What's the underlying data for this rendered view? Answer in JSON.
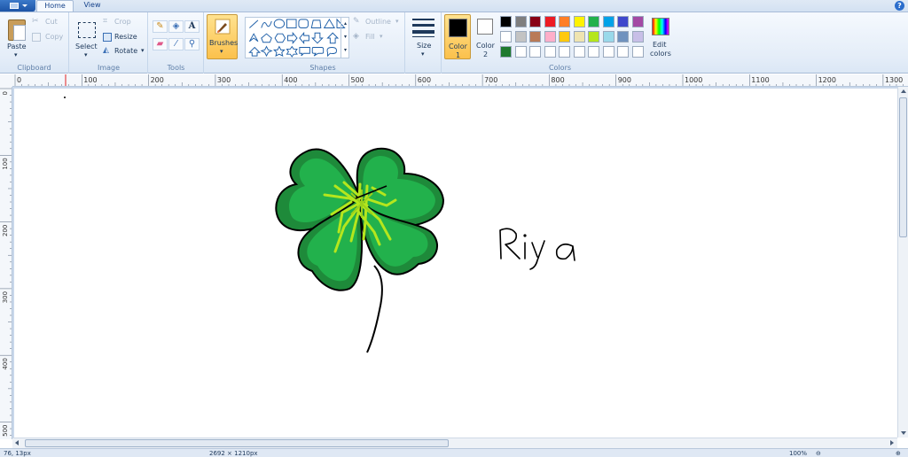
{
  "tabs": {
    "home": "Home",
    "view": "View"
  },
  "help_icon": "?",
  "clipboard": {
    "paste": "Paste",
    "cut": "Cut",
    "copy": "Copy",
    "label": "Clipboard"
  },
  "image": {
    "select": "Select",
    "crop": "Crop",
    "resize": "Resize",
    "rotate": "Rotate",
    "label": "Image"
  },
  "tools": {
    "label": "Tools",
    "text_tool": "A"
  },
  "brushes": {
    "label": "Brushes"
  },
  "shapes": {
    "outline": "Outline",
    "fill": "Fill",
    "label": "Shapes"
  },
  "size": {
    "label": "Size"
  },
  "colors": {
    "color1_label": "Color",
    "color1_num": "1",
    "color2_label": "Color",
    "color2_num": "2",
    "edit_label_1": "Edit",
    "edit_label_2": "colors",
    "label": "Colors",
    "color1_value": "#000000",
    "color2_value": "#ffffff",
    "palette": [
      "#000000",
      "#7f7f7f",
      "#880015",
      "#ed1c24",
      "#ff7f27",
      "#fff200",
      "#22b14c",
      "#00a2e8",
      "#3f48cc",
      "#a349a4",
      "#ffffff",
      "#c3c3c3",
      "#b97a57",
      "#ffaec9",
      "#ffc90e",
      "#efe4b0",
      "#b5e61d",
      "#99d9ea",
      "#7092be",
      "#c8bfe7",
      "#1e7a2f",
      "#ffffff",
      "#ffffff",
      "#ffffff",
      "#ffffff",
      "#ffffff",
      "#ffffff",
      "#ffffff",
      "#ffffff",
      "#ffffff"
    ]
  },
  "ruler": {
    "h_labels": [
      "0",
      "100",
      "200",
      "300",
      "400",
      "500",
      "600",
      "700",
      "800",
      "900",
      "1000",
      "1100",
      "1200",
      "1300"
    ],
    "v_labels": [
      "0",
      "100",
      "200",
      "300",
      "400",
      "500"
    ]
  },
  "canvas": {
    "signature_text": "Riya",
    "colors": {
      "leaf_dark": "#1e8a3a",
      "leaf_light": "#22b14c",
      "center": "#b5e61d",
      "outline": "#000000"
    }
  },
  "status": {
    "cursor_pos": "76, 13px",
    "selection": "",
    "dimensions": "2692 × 1210px",
    "zoom": "100%"
  }
}
